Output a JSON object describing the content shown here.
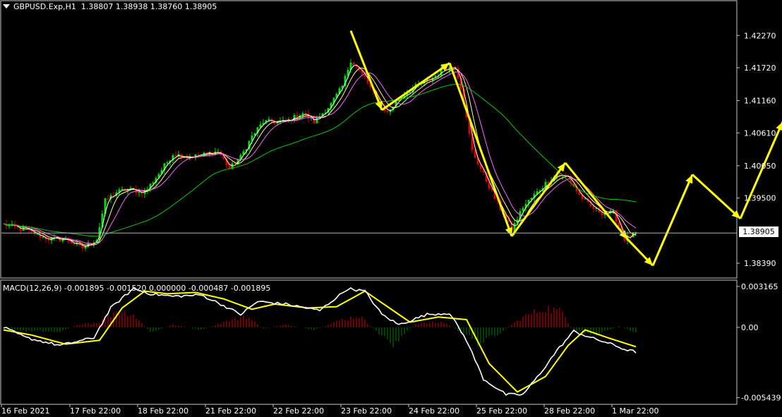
{
  "header": {
    "symbol": "GBPUSD.Exp,H1",
    "ohlc": "1.38807 1.38938 1.38760 1.38905"
  },
  "macd_header": "MACD(12,26,9) -0.001895 -0.001520 0.000000 -0.000487 -0.001895",
  "current_price": "1.38905",
  "colors": {
    "background": "#000000",
    "bull_candle": "#00e000",
    "bear_candle": "#e00000",
    "ma_fast": "#ffffff",
    "ma_mid": "#ffff99",
    "ma_slow": "#ff66ff",
    "ma_long": "#00cc00",
    "arrows": "#ffff00",
    "macd_line": "#ffffff",
    "signal_line": "#ffff00",
    "hist_pos": "#e00000",
    "hist_neg": "#008000"
  },
  "chart_data": [
    {
      "type": "line",
      "title": "GBPUSD.Exp,H1",
      "ylim": [
        1.3815,
        1.4285
      ],
      "y_ticks": [
        "1.42270",
        "1.41720",
        "1.41160",
        "1.40610",
        "1.40050",
        "1.39500",
        "1.38905",
        "1.38390"
      ],
      "y_tick_values": [
        1.4227,
        1.4172,
        1.4116,
        1.4061,
        1.4005,
        1.395,
        1.38905,
        1.3839
      ],
      "x_ticks": [
        "16 Feb 2021",
        "17 Feb 22:00",
        "18 Feb 22:00",
        "21 Feb 22:00",
        "22 Feb 22:00",
        "23 Feb 22:00",
        "24 Feb 22:00",
        "25 Feb 22:00",
        "28 Feb 22:00",
        "1 Mar 22:00"
      ],
      "x_tick_bars": [
        0,
        24,
        48,
        72,
        96,
        120,
        144,
        168,
        192,
        216
      ],
      "bar_count": 224,
      "close_anchors": [
        [
          0,
          1.3905
        ],
        [
          8,
          1.3895
        ],
        [
          16,
          1.388
        ],
        [
          22,
          1.388
        ],
        [
          28,
          1.3865
        ],
        [
          33,
          1.388
        ],
        [
          36,
          1.3945
        ],
        [
          40,
          1.396
        ],
        [
          44,
          1.3965
        ],
        [
          50,
          1.396
        ],
        [
          54,
          1.3985
        ],
        [
          60,
          1.4025
        ],
        [
          66,
          1.402
        ],
        [
          72,
          1.4025
        ],
        [
          76,
          1.403
        ],
        [
          80,
          1.4
        ],
        [
          84,
          1.402
        ],
        [
          88,
          1.4055
        ],
        [
          92,
          1.408
        ],
        [
          100,
          1.408
        ],
        [
          106,
          1.4095
        ],
        [
          110,
          1.408
        ],
        [
          116,
          1.411
        ],
        [
          120,
          1.414
        ],
        [
          123,
          1.4185
        ],
        [
          128,
          1.4155
        ],
        [
          132,
          1.412
        ],
        [
          136,
          1.4095
        ],
        [
          140,
          1.412
        ],
        [
          146,
          1.414
        ],
        [
          152,
          1.4155
        ],
        [
          156,
          1.417
        ],
        [
          160,
          1.4175
        ],
        [
          162,
          1.414
        ],
        [
          166,
          1.403
        ],
        [
          170,
          1.399
        ],
        [
          174,
          1.395
        ],
        [
          178,
          1.3915
        ],
        [
          180,
          1.3895
        ],
        [
          184,
          1.3935
        ],
        [
          188,
          1.3955
        ],
        [
          192,
          1.3975
        ],
        [
          196,
          1.399
        ],
        [
          200,
          1.3985
        ],
        [
          204,
          1.3955
        ],
        [
          208,
          1.3935
        ],
        [
          212,
          1.3925
        ],
        [
          216,
          1.3925
        ],
        [
          220,
          1.388
        ],
        [
          224,
          1.389
        ]
      ],
      "zigzag_arrows": [
        [
          123,
          1.4235
        ],
        [
          134,
          1.41
        ],
        [
          158,
          1.418
        ],
        [
          180,
          1.3885
        ],
        [
          199,
          1.401
        ],
        [
          221,
          1.388
        ],
        [
          230,
          1.3835
        ],
        [
          244,
          1.399
        ],
        [
          261,
          1.3915
        ],
        [
          276,
          1.408
        ]
      ]
    },
    {
      "type": "bar",
      "title": "MACD(12,26,9)",
      "ylim": [
        -0.0059,
        0.0036
      ],
      "y_ticks": [
        "0.003165",
        "0.00",
        "-0.005439"
      ],
      "y_tick_values": [
        0.003165,
        0,
        -0.005439
      ],
      "macd_anchors": [
        [
          0,
          0.0
        ],
        [
          8,
          -0.0008
        ],
        [
          20,
          -0.0014
        ],
        [
          32,
          -0.0008
        ],
        [
          38,
          0.0015
        ],
        [
          46,
          0.003
        ],
        [
          52,
          0.0026
        ],
        [
          60,
          0.0024
        ],
        [
          70,
          0.0025
        ],
        [
          76,
          0.0019
        ],
        [
          84,
          0.001
        ],
        [
          90,
          0.002
        ],
        [
          100,
          0.0018
        ],
        [
          112,
          0.0013
        ],
        [
          122,
          0.003
        ],
        [
          128,
          0.0028
        ],
        [
          134,
          0.001
        ],
        [
          140,
          0.0002
        ],
        [
          150,
          0.001
        ],
        [
          158,
          0.0011
        ],
        [
          164,
          -0.001
        ],
        [
          170,
          -0.004
        ],
        [
          178,
          -0.0052
        ],
        [
          184,
          -0.0052
        ],
        [
          190,
          -0.0036
        ],
        [
          196,
          -0.0018
        ],
        [
          202,
          -0.0003
        ],
        [
          208,
          -0.0008
        ],
        [
          214,
          -0.0012
        ],
        [
          220,
          -0.0017
        ],
        [
          224,
          -0.0019
        ]
      ],
      "signal_anchors": [
        [
          0,
          -0.0002
        ],
        [
          10,
          -0.0006
        ],
        [
          22,
          -0.0013
        ],
        [
          34,
          -0.001
        ],
        [
          42,
          0.0015
        ],
        [
          50,
          0.0028
        ],
        [
          58,
          0.0026
        ],
        [
          68,
          0.0027
        ],
        [
          78,
          0.0022
        ],
        [
          88,
          0.0014
        ],
        [
          96,
          0.0018
        ],
        [
          108,
          0.0015
        ],
        [
          118,
          0.0016
        ],
        [
          128,
          0.0028
        ],
        [
          136,
          0.0016
        ],
        [
          144,
          0.0004
        ],
        [
          154,
          0.0008
        ],
        [
          164,
          0.0006
        ],
        [
          172,
          -0.0028
        ],
        [
          182,
          -0.005
        ],
        [
          192,
          -0.0038
        ],
        [
          200,
          -0.0014
        ],
        [
          206,
          -0.0002
        ],
        [
          214,
          -0.0008
        ],
        [
          224,
          -0.0015
        ]
      ],
      "hist_anchors": [
        [
          0,
          -0.0001
        ],
        [
          10,
          -0.0003
        ],
        [
          20,
          -0.0003
        ],
        [
          28,
          0.0003
        ],
        [
          34,
          0.0004
        ],
        [
          40,
          0.0013
        ],
        [
          46,
          0.001
        ],
        [
          52,
          -0.0004
        ],
        [
          60,
          0.0002
        ],
        [
          70,
          -0.0002
        ],
        [
          78,
          0.0004
        ],
        [
          86,
          0.0009
        ],
        [
          92,
          -0.0001
        ],
        [
          100,
          0.0002
        ],
        [
          110,
          -0.0002
        ],
        [
          120,
          0.0006
        ],
        [
          126,
          0.0009
        ],
        [
          132,
          -0.0003
        ],
        [
          138,
          -0.0013
        ],
        [
          146,
          0.0003
        ],
        [
          156,
          0.0004
        ],
        [
          162,
          -0.0004
        ],
        [
          168,
          -0.0012
        ],
        [
          176,
          -0.0004
        ],
        [
          184,
          0.0008
        ],
        [
          192,
          0.0015
        ],
        [
          198,
          0.0012
        ],
        [
          202,
          -0.0003
        ],
        [
          210,
          -0.0006
        ],
        [
          218,
          0.0001
        ],
        [
          224,
          -0.0004
        ]
      ]
    }
  ]
}
